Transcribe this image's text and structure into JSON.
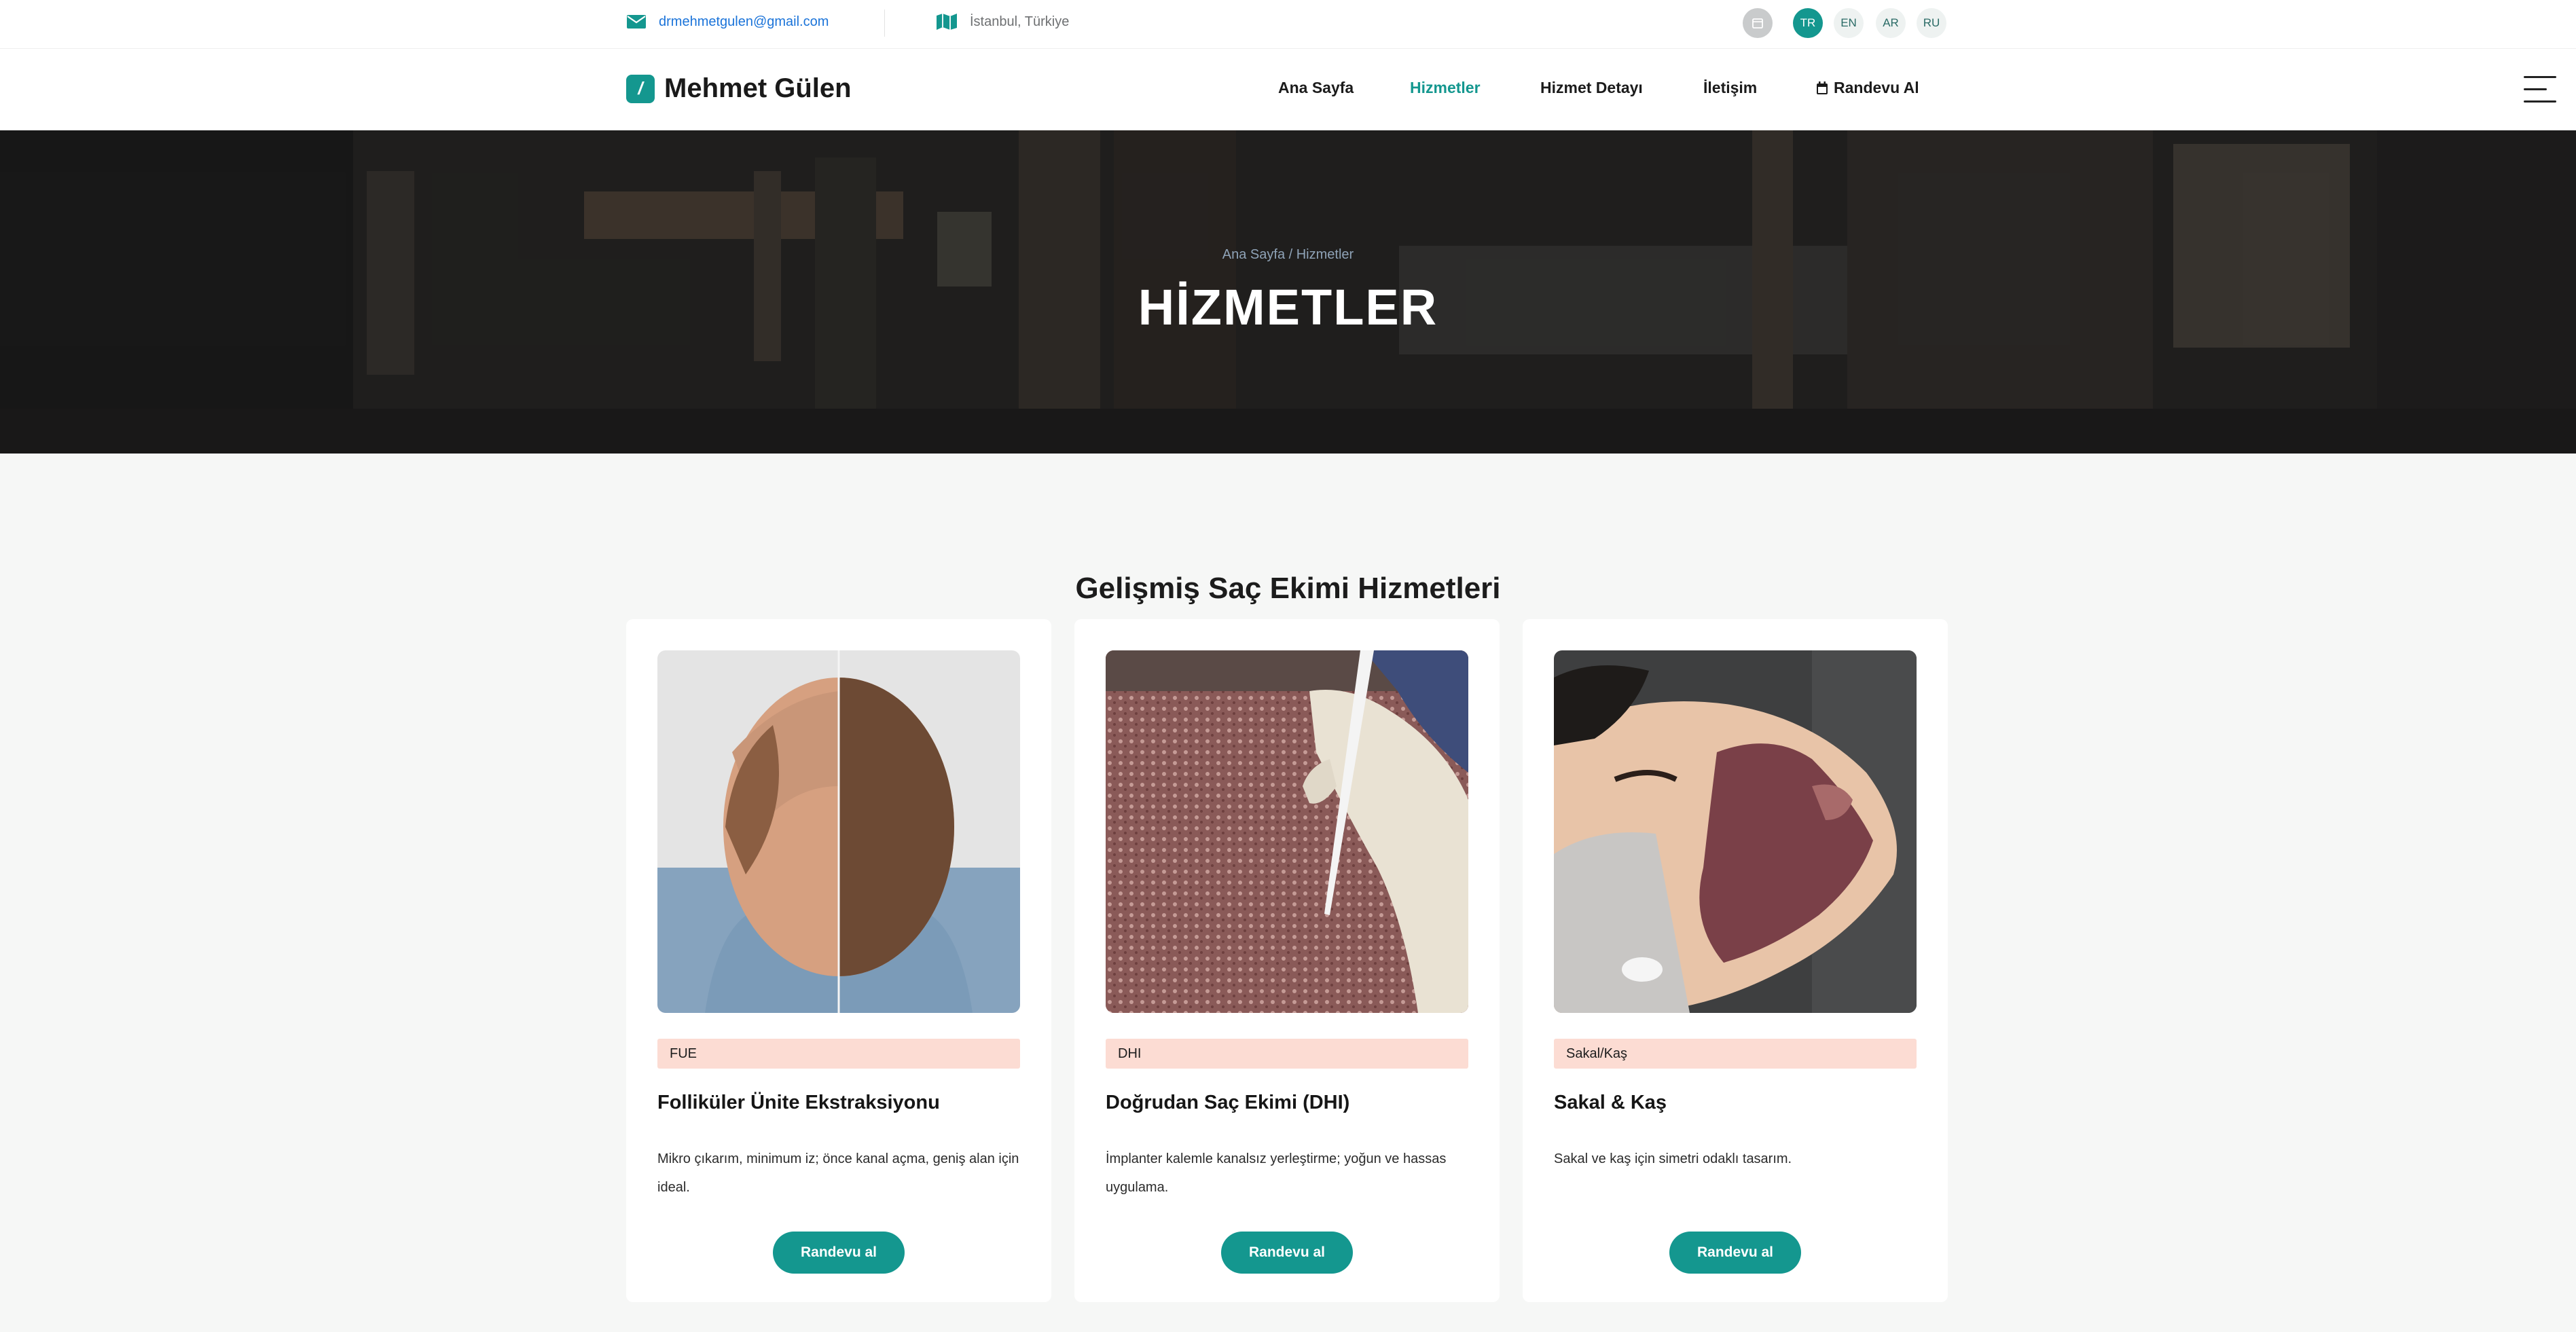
{
  "topbar": {
    "email": "drmehmetgulen@gmail.com",
    "location": "İstanbul, Türkiye",
    "languages": [
      "TR",
      "EN",
      "AR",
      "RU"
    ],
    "active_language": "TR"
  },
  "nav": {
    "brand": "Mehmet Gülen",
    "brand_mark": "/",
    "items": [
      {
        "label": "Ana Sayfa"
      },
      {
        "label": "Hizmetler"
      },
      {
        "label": "Hizmet Detayı"
      },
      {
        "label": "İletişim"
      },
      {
        "label": "Randevu Al"
      }
    ],
    "active_item": "Hizmetler"
  },
  "hero": {
    "breadcrumb": "Ana Sayfa / Hizmetler",
    "title": "HİZMETLER"
  },
  "services": {
    "heading": "Gelişmiş Saç Ekimi Hizmetleri",
    "cards": [
      {
        "tag": "FUE",
        "title": "Folliküler Ünite Ekstraksiyonu",
        "description": "Mikro çıkarım, minimum iz; önce kanal açma, geniş alan için ideal.",
        "button": "Randevu al"
      },
      {
        "tag": "DHI",
        "title": "Doğrudan Saç Ekimi (DHI)",
        "description": "İmplanter kalemle kanalsız yerleştirme; yoğun ve hassas uygulama.",
        "button": "Randevu al"
      },
      {
        "tag": "Sakal/Kaş",
        "title": "Sakal & Kaş",
        "description": "Sakal ve kaş için simetri odaklı tasarım.",
        "button": "Randevu al"
      }
    ]
  },
  "colors": {
    "accent": "#14978f",
    "tag_bg": "#fcdcd3",
    "link": "#1a73d9"
  }
}
